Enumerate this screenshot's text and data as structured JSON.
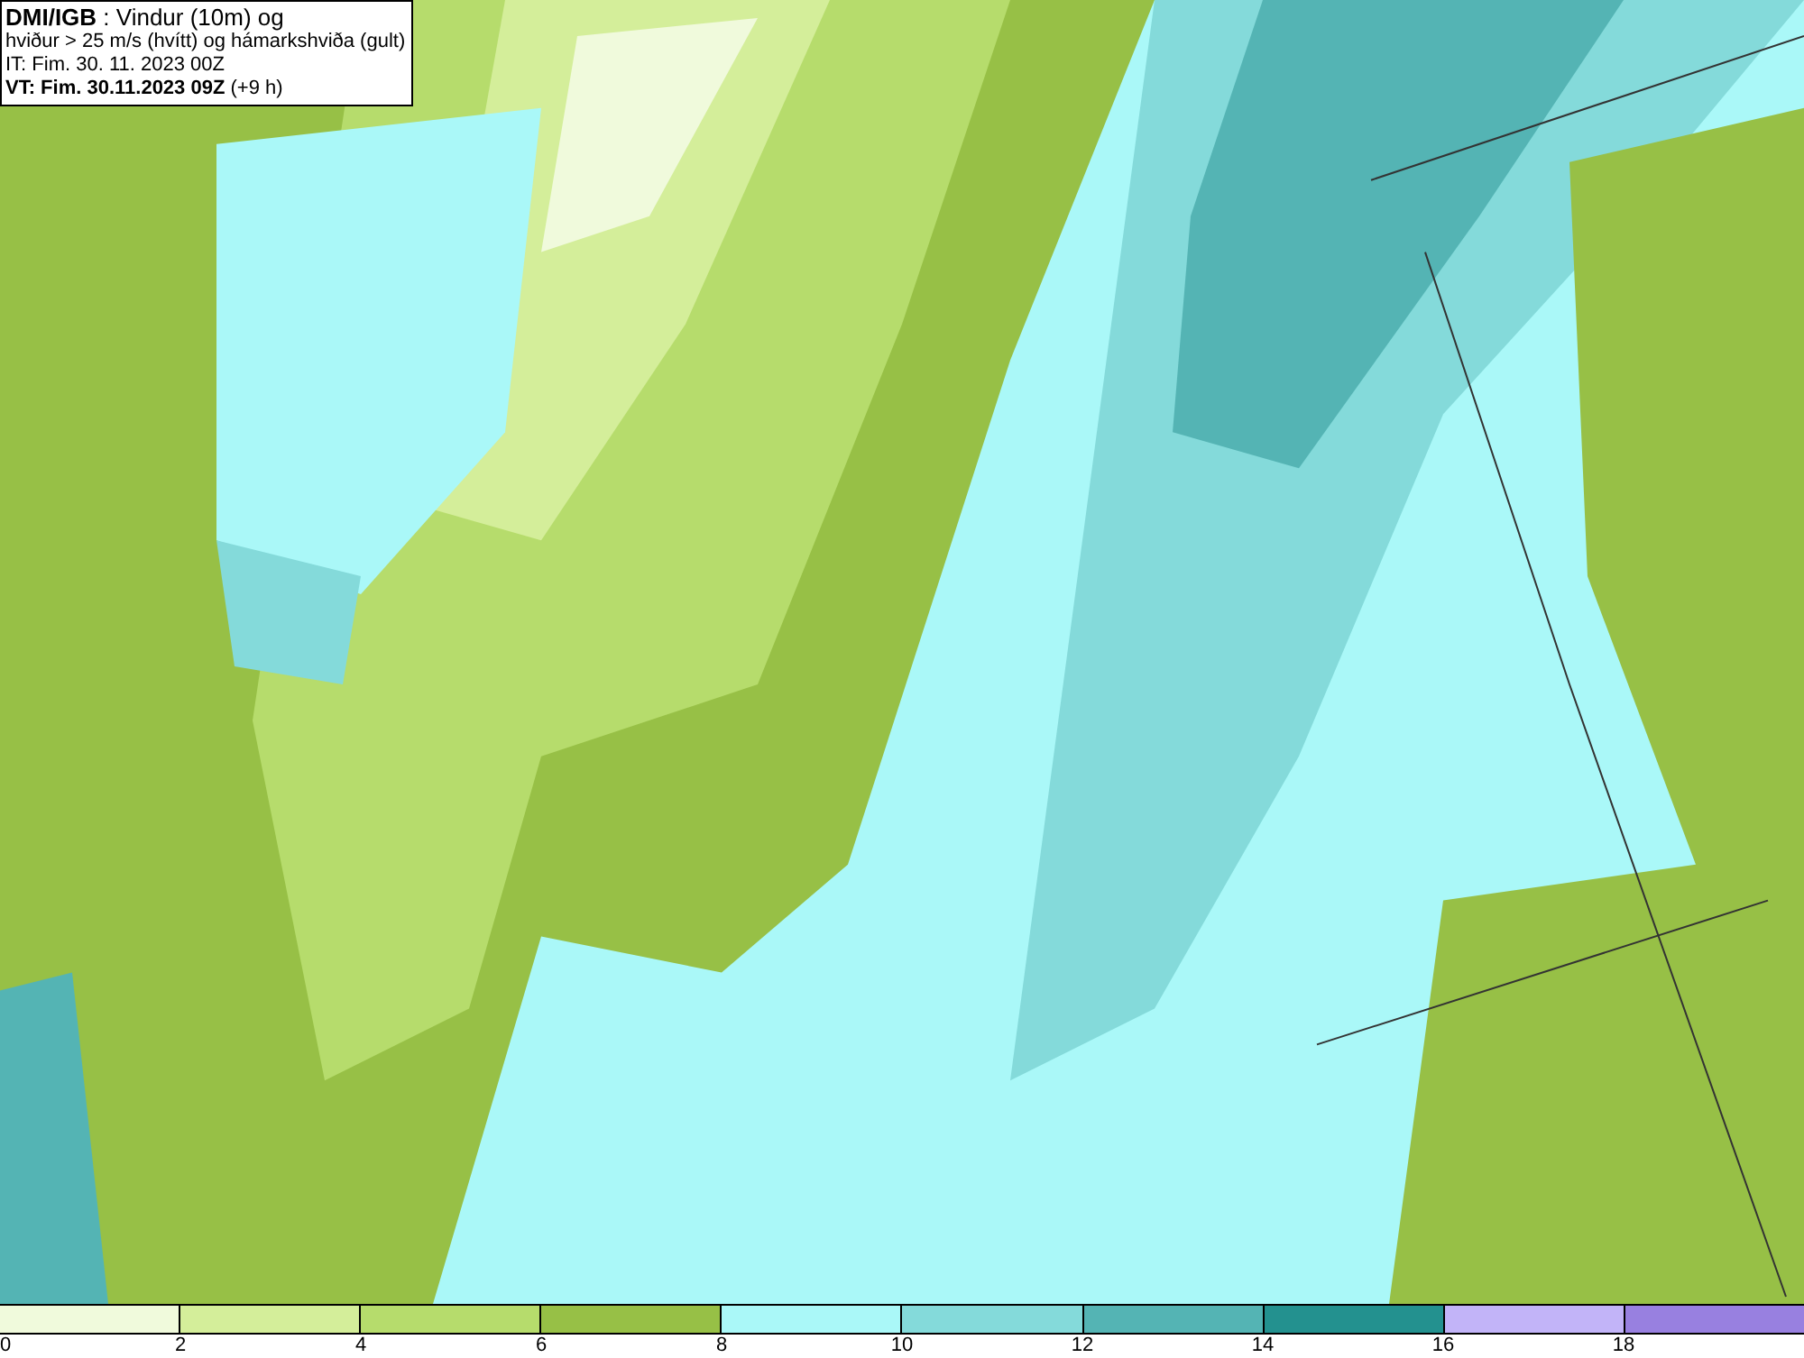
{
  "header": {
    "lines": [
      "**DMI/IGB** : Vindur (10m) og",
      "hviður > 25 m/s (hvítt) og hámarkshviða (gult)",
      "IT: Fim. 30. 11. 2023 00Z",
      "**VT: Fim. 30.11.2023 09Z** (+9 h)"
    ]
  },
  "colorbar": {
    "segments": [
      {
        "color": "#f0fadc",
        "label": "0"
      },
      {
        "color": "#d4ee9a",
        "label": "2"
      },
      {
        "color": "#b6dc6c",
        "label": "4"
      },
      {
        "color": "#97c046",
        "label": "6"
      },
      {
        "color": "#aaf8f8",
        "label": "8"
      },
      {
        "color": "#84dada",
        "label": "10"
      },
      {
        "color": "#54b4b4",
        "label": "12"
      },
      {
        "color": "#23918f",
        "label": "14"
      },
      {
        "color": "#c2b4f8",
        "label": "16"
      },
      {
        "color": "#9880e0",
        "label": "18"
      }
    ]
  }
}
